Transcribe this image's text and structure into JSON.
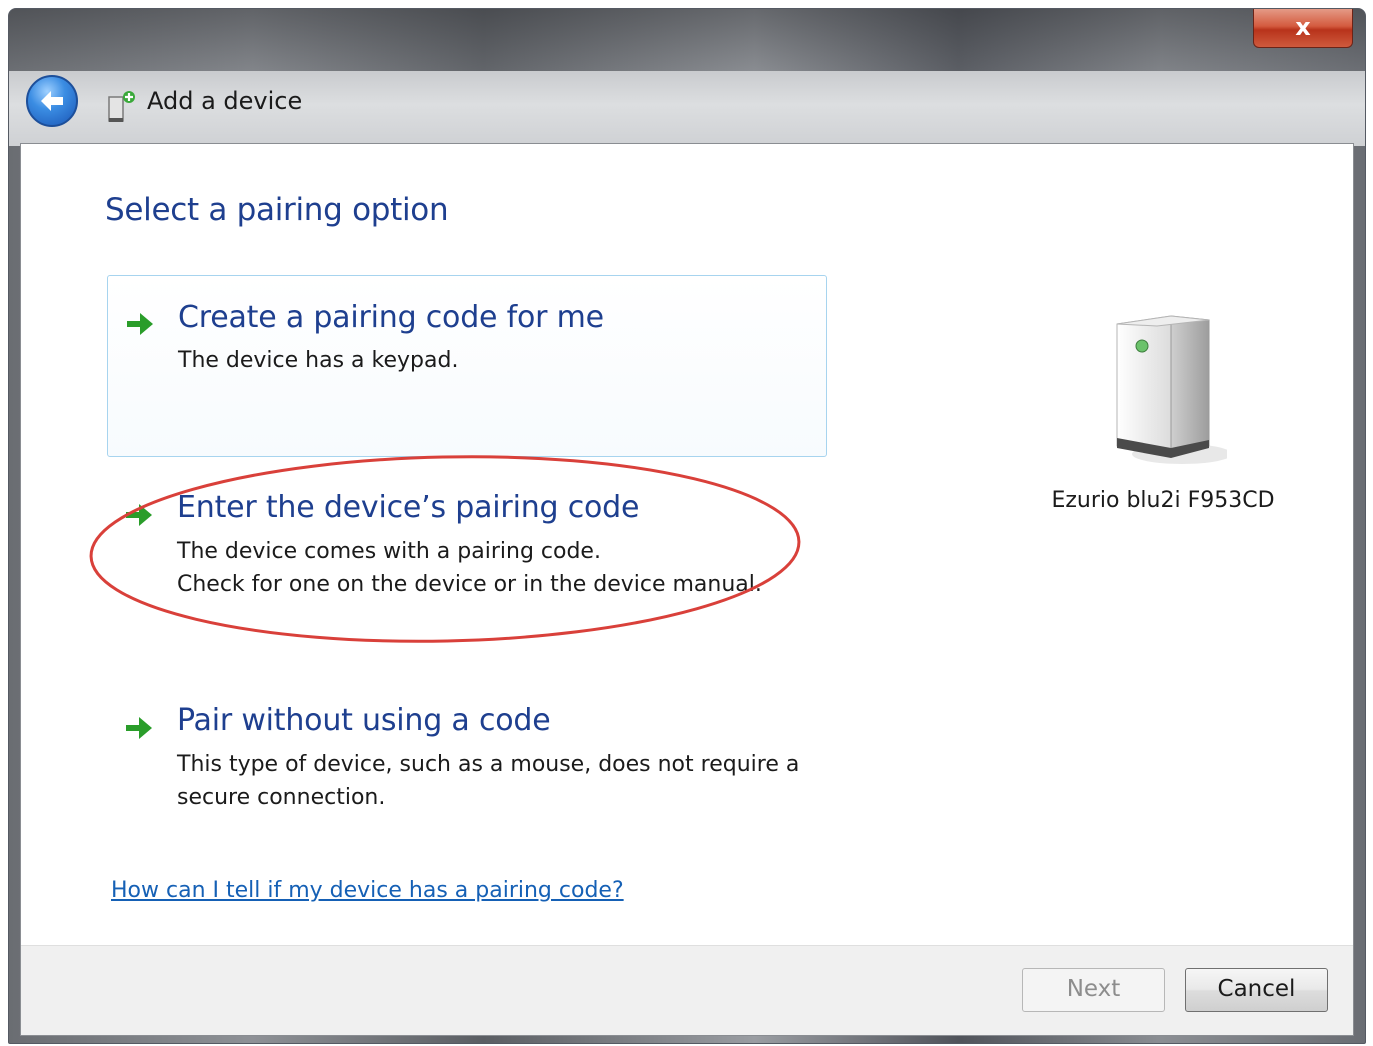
{
  "window": {
    "title": "Add a device",
    "close_label": "x"
  },
  "content": {
    "heading": "Select a pairing option",
    "options": [
      {
        "title": "Create a pairing code for me",
        "description": [
          "The device has a keypad."
        ]
      },
      {
        "title": "Enter the device’s pairing code",
        "description": [
          "The device comes with a pairing code.",
          "Check for one on the device or in the device manual."
        ]
      },
      {
        "title": "Pair without using a code",
        "description": [
          "This type of device, such as a mouse, does not require a",
          "secure connection."
        ]
      }
    ],
    "help_link": "How can I tell if my device has a pairing code?"
  },
  "device": {
    "name": "Ezurio blu2i F953CD",
    "icon": "device-tower-icon"
  },
  "footer": {
    "next_label": "Next",
    "cancel_label": "Cancel"
  },
  "colors": {
    "heading": "#1e3f8f",
    "link": "#1560b5",
    "annotation": "#d9403a",
    "arrow": "#2a9d2a"
  }
}
